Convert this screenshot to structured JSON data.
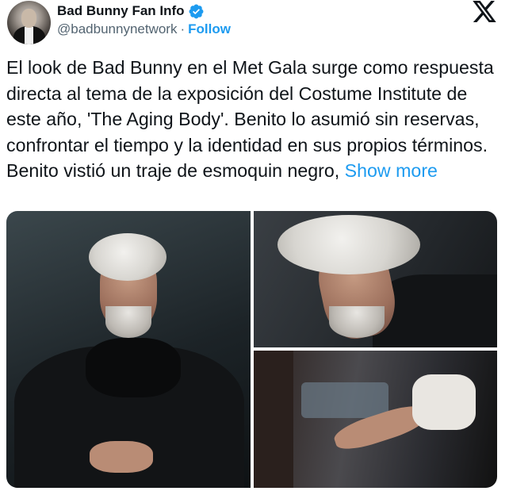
{
  "author": {
    "display_name": "Bad Bunny Fan Info",
    "handle": "@badbunnynetwork",
    "separator": "·",
    "follow_label": "Follow",
    "verified": true
  },
  "tweet": {
    "text": "El look de Bad Bunny en el Met Gala surge como respuesta directa al tema de la exposición del Costume Institute de este año, 'The Aging Body'. Benito lo asumió sin reservas, confrontar el tiempo y la identidad en sus propios términos. Benito vistió un traje de esmoquin negro,",
    "show_more_label": "Show more"
  },
  "colors": {
    "accent": "#1d9bf0",
    "text": "#0f1419",
    "secondary": "#536471"
  },
  "icons": {
    "platform": "x-logo-icon",
    "verified": "verified-badge-icon"
  }
}
